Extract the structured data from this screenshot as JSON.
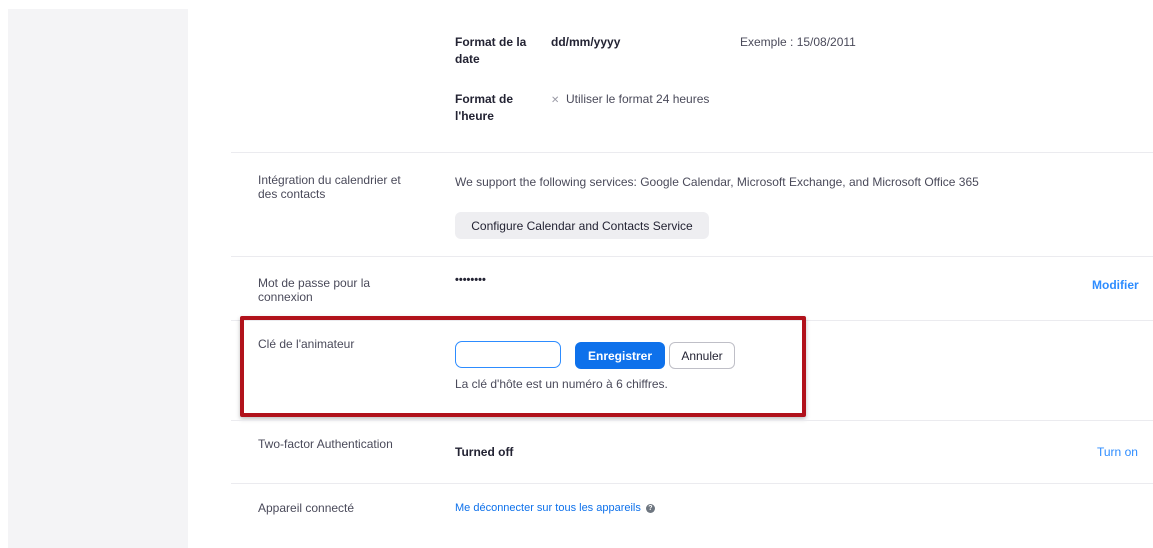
{
  "date_format": {
    "label": "Format de la date",
    "value": "dd/mm/yyyy",
    "example": "Exemple : 15/08/2011"
  },
  "time_format": {
    "label": "Format de l'heure",
    "checkbox_mark": "✕",
    "option": "Utiliser le format 24 heures"
  },
  "calendar": {
    "label": "Intégration du calendrier et des contacts",
    "description": "We support the following services: Google Calendar, Microsoft Exchange, and Microsoft Office 365",
    "button": "Configure Calendar and Contacts Service"
  },
  "password": {
    "label": "Mot de passe pour la connexion",
    "value": "••••••••",
    "action": "Modifier"
  },
  "host_key": {
    "label": "Clé de l'animateur",
    "input_value": "",
    "save": "Enregistrer",
    "cancel": "Annuler",
    "hint": "La clé d'hôte est un numéro à 6 chiffres."
  },
  "two_factor": {
    "label": "Two-factor Authentication",
    "status": "Turned off",
    "action": "Turn on"
  },
  "devices": {
    "label": "Appareil connecté",
    "action": "Me déconnecter sur tous les appareils",
    "help_icon": "question-circle-icon"
  },
  "colors": {
    "accent_blue": "#0e71eb",
    "highlight_red": "#b1121b",
    "sidebar_bg": "#f4f4f6"
  }
}
